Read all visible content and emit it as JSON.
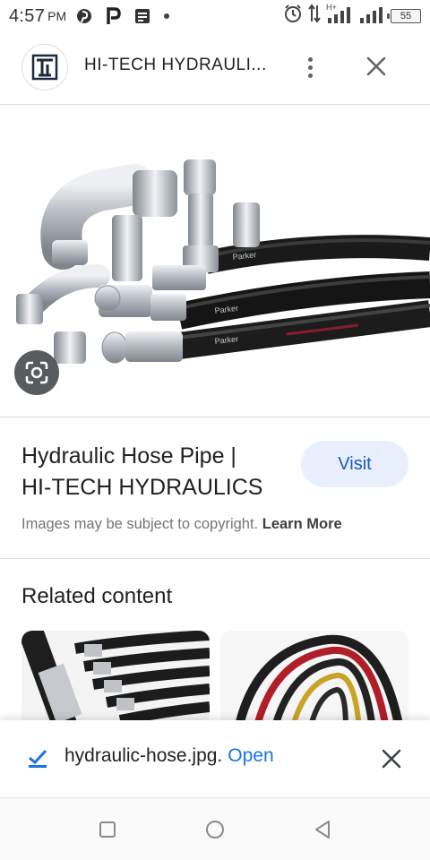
{
  "status_bar": {
    "time": "4:57",
    "ampm": "PM",
    "battery": "55",
    "left_icons": [
      "pinterest-icon",
      "parking-icon",
      "message-icon",
      "dot-icon"
    ],
    "right_icons": [
      "alarm-icon",
      "data-arrows-icon",
      "signal-h-plus-icon",
      "signal-icon",
      "battery-icon"
    ]
  },
  "header": {
    "site_logo": "hi-tech-logo",
    "site_title": "HI-TECH HYDRAULI..."
  },
  "result": {
    "title_line1": "Hydraulic Hose Pipe |",
    "title_line2": "HI-TECH HYDRAULICS",
    "visit_label": "Visit",
    "copyright_text": "Images may be subject to copyright.",
    "learn_more": "Learn More"
  },
  "related": {
    "title": "Related content"
  },
  "download": {
    "filename": "hydraulic-hose.jpg.",
    "open_label": "Open"
  },
  "colors": {
    "accent": "#1a73e8",
    "visit_bg": "#e8f0fe",
    "hose_black": "#1c1c1c",
    "fitting_silver": "#c9ccd1"
  }
}
